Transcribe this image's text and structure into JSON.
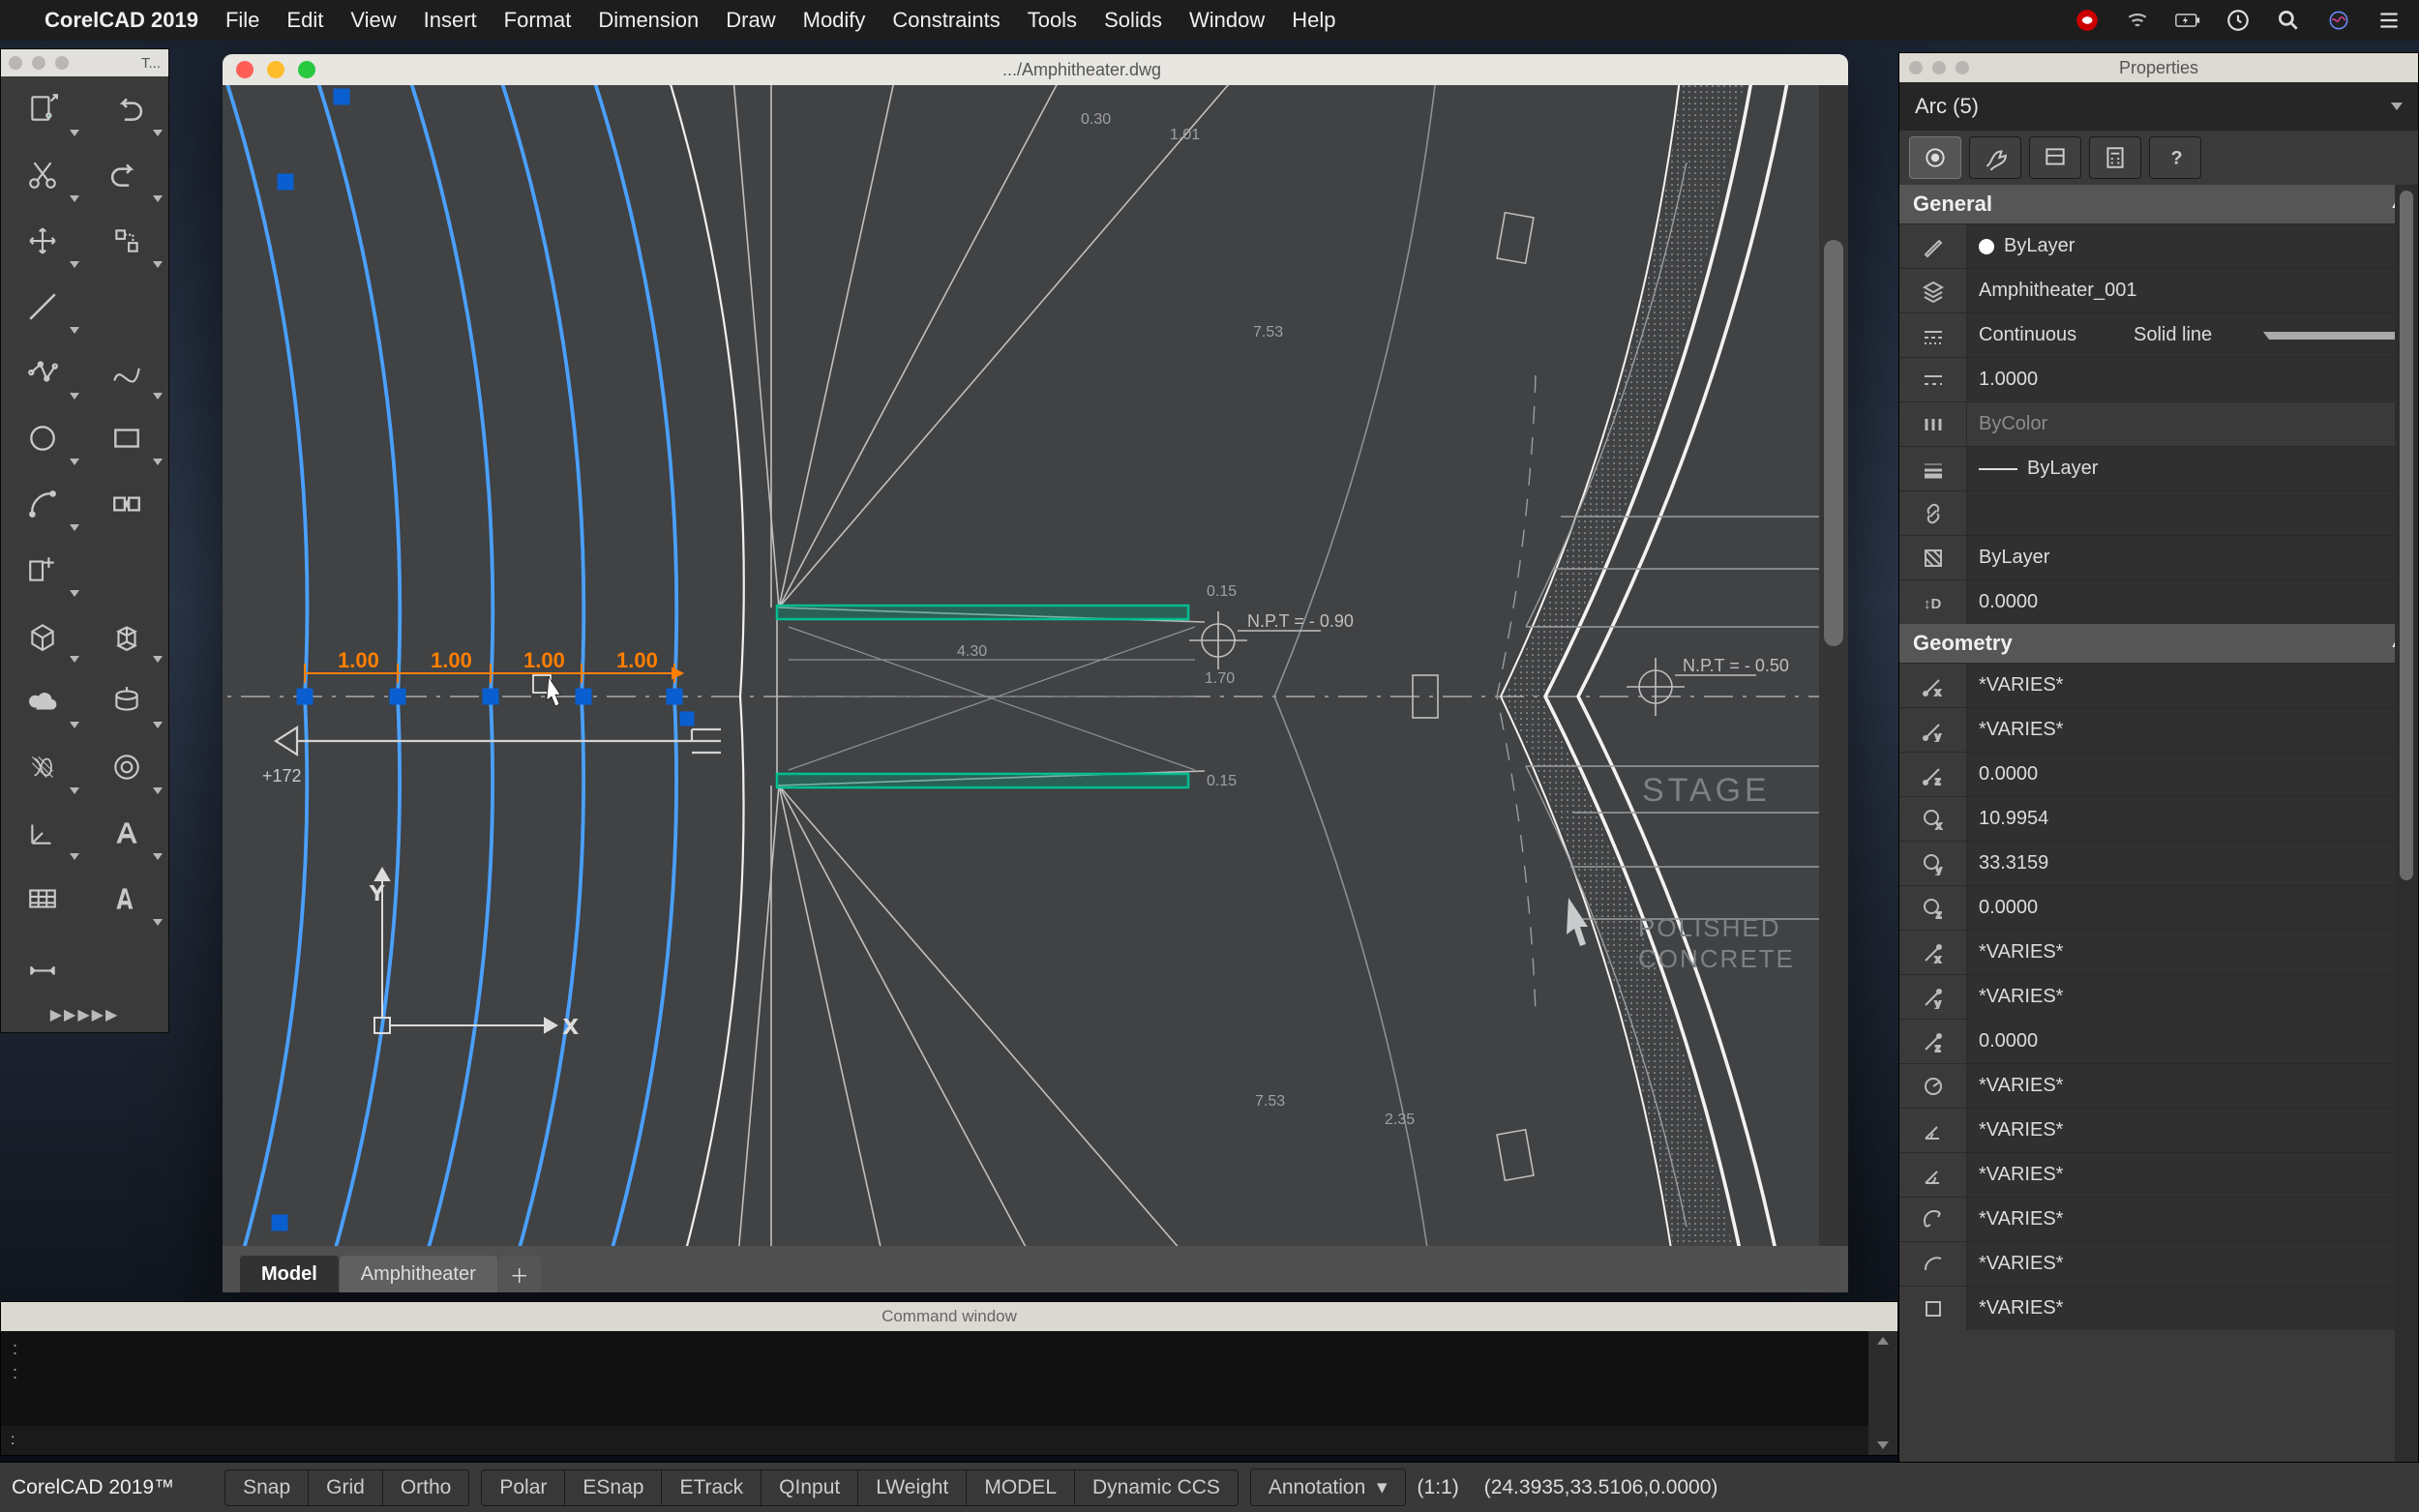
{
  "menubar": {
    "app_name": "CorelCAD 2019",
    "items": [
      "File",
      "Edit",
      "View",
      "Insert",
      "Format",
      "Dimension",
      "Draw",
      "Modify",
      "Constraints",
      "Tools",
      "Solids",
      "Window",
      "Help"
    ],
    "battery": "⚡"
  },
  "tool_palette": {
    "title": "T..."
  },
  "drawing": {
    "title": ".../Amphitheater.dwg",
    "tabs": {
      "active": "Model",
      "other": "Amphitheater"
    },
    "dims": {
      "d1": "1.00",
      "d2": "1.00",
      "d3": "1.00",
      "d4": "1.00"
    },
    "labels": {
      "stage": "STAGE",
      "polished1": "POLISHED",
      "polished2": "CONCRETE",
      "npt1": "N.P.T = - 0.90",
      "npt2": "N.P.T = - 0.50",
      "lvl": "+172",
      "m030": "0.30",
      "m101": "1.01",
      "m753t": "7.53",
      "m015t": "0.15",
      "m170": "1.70",
      "m430": "4.30",
      "m015b": "0.15",
      "m753b": "7.53",
      "m235": "2.35"
    }
  },
  "properties": {
    "panel_title": "Properties",
    "selection": "Arc (5)",
    "sections": {
      "general": "General",
      "geometry": "Geometry"
    },
    "general": {
      "color": "ByLayer",
      "layer": "Amphitheater_001",
      "linetype_left": "Continuous",
      "linetype_right": "Solid line",
      "linescale": "1.0000",
      "plotstyle": "ByColor",
      "lineweight": "ByLayer",
      "hyperlink": "",
      "transparency": "ByLayer",
      "thickness": "0.0000"
    },
    "geometry": {
      "start_x": "*VARIES*",
      "start_y": "*VARIES*",
      "start_z": "0.0000",
      "center_x": "10.9954",
      "center_y": "33.3159",
      "center_z": "0.0000",
      "end_x": "*VARIES*",
      "end_y": "*VARIES*",
      "end_z": "0.0000",
      "radius": "*VARIES*",
      "start_angle": "*VARIES*",
      "end_angle": "*VARIES*",
      "total_angle": "*VARIES*",
      "arc_length": "*VARIES*",
      "area": "*VARIES*"
    }
  },
  "command_window": {
    "title": "Command window",
    "prompt": ": "
  },
  "status": {
    "brand": "CorelCAD 2019™",
    "group1": [
      "Snap",
      "Grid",
      "Ortho"
    ],
    "group2": [
      "Polar",
      "ESnap",
      "ETrack",
      "QInput",
      "LWeight",
      "MODEL",
      "Dynamic CCS"
    ],
    "annotation": "Annotation",
    "scale": "(1:1)",
    "coord": "(24.3935,33.5106,0.0000)"
  }
}
